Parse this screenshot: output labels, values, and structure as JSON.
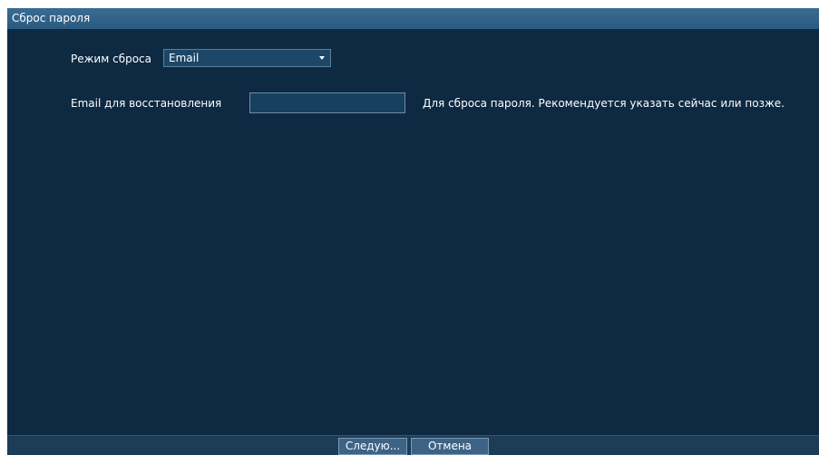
{
  "window": {
    "title": "Сброс пароля"
  },
  "form": {
    "reset_mode_label": "Режим сброса",
    "reset_mode_value": "Email",
    "email_label": "Email для восстановления",
    "email_value": "",
    "email_hint": "Для сброса пароля. Рекомендуется указать сейчас или позже."
  },
  "footer": {
    "next_label": "Следую...",
    "cancel_label": "Отмена"
  },
  "icons": {
    "dropdown": "chevron-down-icon"
  }
}
